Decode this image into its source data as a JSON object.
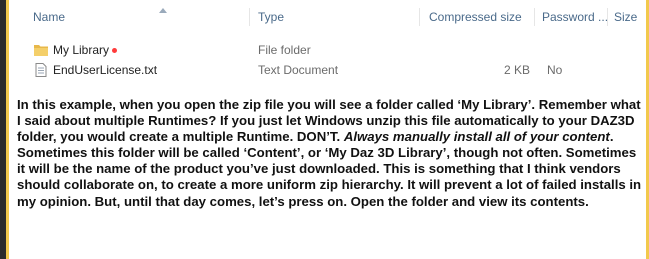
{
  "columns": {
    "name": "Name",
    "type": "Type",
    "compressed_size": "Compressed size",
    "password": "Password ...",
    "size": "Size"
  },
  "files": [
    {
      "icon": "folder-icon",
      "name": "My Library",
      "type": "File folder",
      "compressed_size": "",
      "password": ""
    },
    {
      "icon": "text-document-icon",
      "name": "EndUserLicense.txt",
      "type": "Text Document",
      "compressed_size": "2 KB",
      "password": "No"
    }
  ],
  "caption": {
    "p1": "In this example, when you open the zip file you will see a folder called ‘My Library’. Remember what I said about multiple Runtimes? If you just let Windows unzip this file automatically to your DAZ3D folder, you would create a multiple Runtime. DON’T. ",
    "p2_italic": "Always manually install all of your content",
    "p3": ". Sometimes this folder will be called ‘Content’, or ‘My Daz 3D Library’, though not often. Sometimes it will be the name of the product you’ve just downloaded. This is something that I think vendors should collaborate on, to create a more uniform zip hierarchy. It will prevent a lot of failed installs in my opinion. But, until that day comes, let’s press on. Open the folder and view its contents."
  },
  "colors": {
    "frame_border": "#f2c94c",
    "outer_background": "#2b2b2b",
    "header_text": "#4a6a8a",
    "annotation_dot": "#ff3b3b"
  }
}
